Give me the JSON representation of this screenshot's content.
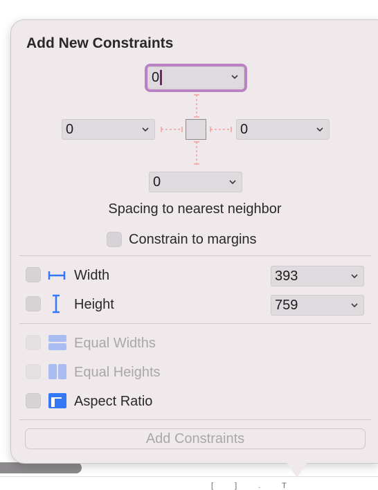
{
  "popover": {
    "title": "Add New Constraints",
    "spacing": {
      "top": "0",
      "left": "0",
      "right": "0",
      "bottom": "0",
      "caption": "Spacing to nearest neighbor"
    },
    "constrain_margins_label": "Constrain to margins",
    "width": {
      "label": "Width",
      "value": "393"
    },
    "height": {
      "label": "Height",
      "value": "759"
    },
    "equal_widths_label": "Equal Widths",
    "equal_heights_label": "Equal Heights",
    "aspect_ratio_label": "Aspect Ratio",
    "add_button_label": "Add Constraints"
  },
  "colors": {
    "popover_bg": "#efe9ec",
    "focus": "#b882c4",
    "accent_blue": "#3478f6",
    "strut_red": "#f0a0a0",
    "disabled_text": "#aaa6a9"
  },
  "icons": {
    "width": "width-bracket-icon",
    "height": "height-bracket-icon",
    "equal_widths": "equal-widths-icon",
    "equal_heights": "equal-heights-icon",
    "aspect_ratio": "aspect-ratio-icon",
    "dropdown": "chevron-down-icon"
  }
}
